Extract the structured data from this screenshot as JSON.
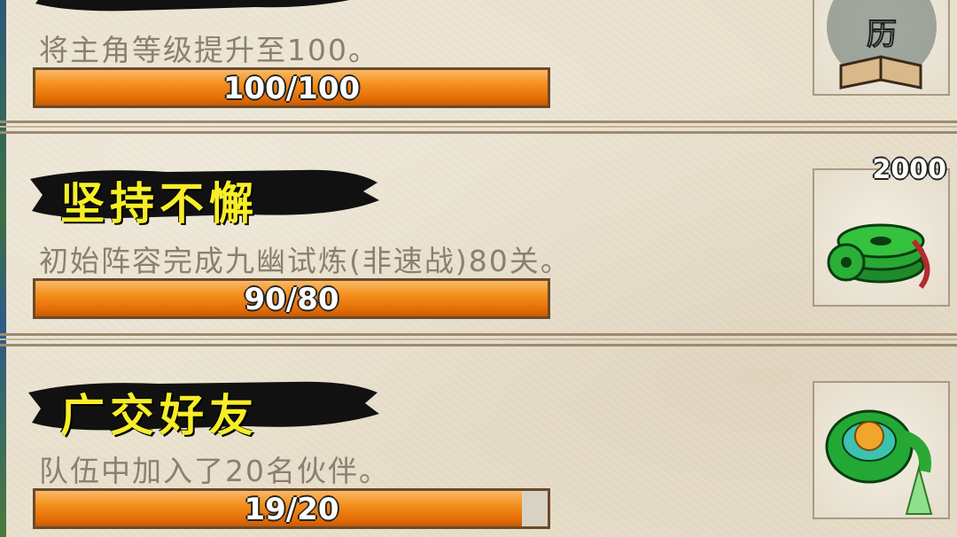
{
  "achievements": [
    {
      "title": "",
      "description": "将主角等级提升至100。",
      "progress_text": "100/100",
      "progress": 1.0,
      "reward_count": "",
      "reward_icon": "book-icon"
    },
    {
      "title": "坚持不懈",
      "description": "初始阵容完成九幽试炼(非速战)80关。",
      "progress_text": "90/80",
      "progress": 1.0,
      "reward_count": "2000",
      "reward_icon": "jade-coins-icon"
    },
    {
      "title": "广交好友",
      "description": "队伍中加入了20名伙伴。",
      "progress_text": "19/20",
      "progress": 0.95,
      "reward_count": "",
      "reward_icon": "jade-pendant-icon"
    }
  ],
  "colors": {
    "title": "#f7ee27",
    "bar_fill": "#f48f1c",
    "description": "#8c7f70"
  }
}
